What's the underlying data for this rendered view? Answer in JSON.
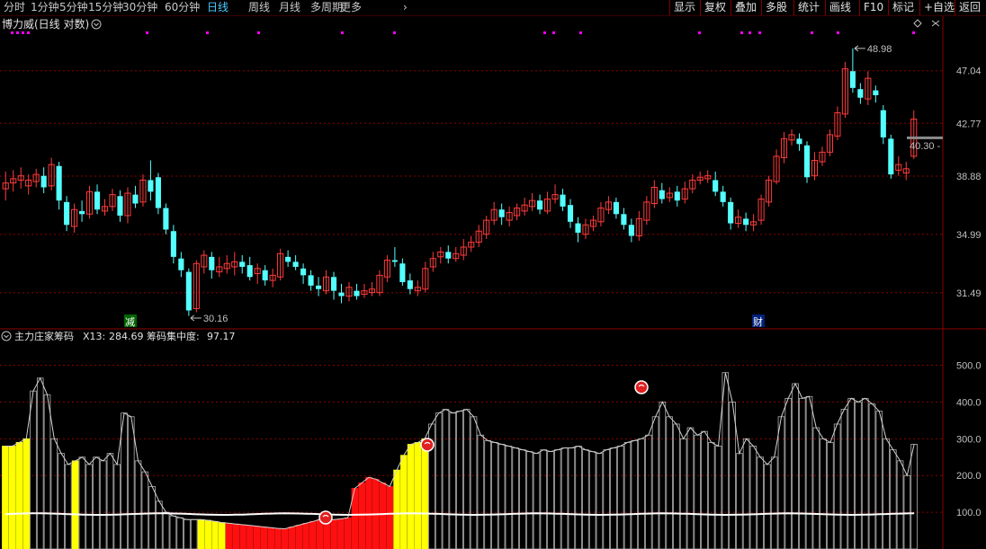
{
  "toolbar": {
    "periods": [
      "分时",
      "1分钟",
      "5分钟",
      "15分钟",
      "30分钟",
      "60分钟",
      "日线",
      "周线",
      "月线",
      "多周期",
      "更多"
    ],
    "active": "日线",
    "more_arrow": "›",
    "right": [
      "显示",
      "复权",
      "叠加",
      "多股",
      "统计",
      "画线",
      "F10",
      "标记",
      "+自选",
      "返回"
    ]
  },
  "colors": {
    "up": "#ff3b3b",
    "down": "#54ffff",
    "grid": "#8b0000",
    "axis": "#c0c0c0",
    "yellow": "#ffff00",
    "red": "#ff1010",
    "gray": "#b0b0b0",
    "line": "#ffffff",
    "accent": "#4ec8ff"
  },
  "main_panel": {
    "title": "博力威(日线 对数)",
    "max_label": "48.98",
    "min_label": "30.16",
    "current_price": "40.30",
    "marker_jian": "减",
    "marker_cai": "财",
    "y_ticks": [
      "47.04",
      "42.77",
      "38.88",
      "34.99",
      "31.49"
    ]
  },
  "indicator": {
    "name": "主力庄家筹码",
    "x13_label": "X13:",
    "x13_value": "284.69",
    "conc_label": "筹码集中度:",
    "conc_value": "97.17",
    "y_ticks": [
      "500.0",
      "400.0",
      "300.0",
      "200.0",
      "100.0"
    ]
  },
  "chart_data": [
    {
      "type": "candlestick",
      "scale": "log",
      "ylim": [
        29.5,
        50.5
      ],
      "candles": [
        {
          "o": 38.0,
          "c": 38.4,
          "h": 39.2,
          "l": 37.2
        },
        {
          "o": 38.4,
          "c": 38.7,
          "h": 39.3,
          "l": 37.8
        },
        {
          "o": 38.6,
          "c": 38.9,
          "h": 39.5,
          "l": 38.0
        },
        {
          "o": 38.2,
          "c": 38.6,
          "h": 39.0,
          "l": 37.6
        },
        {
          "o": 38.5,
          "c": 39.0,
          "h": 39.4,
          "l": 38.1
        },
        {
          "o": 38.9,
          "c": 38.1,
          "h": 39.5,
          "l": 37.7
        },
        {
          "o": 38.2,
          "c": 39.7,
          "h": 40.2,
          "l": 37.9
        },
        {
          "o": 39.6,
          "c": 37.2,
          "h": 39.9,
          "l": 36.6
        },
        {
          "o": 37.1,
          "c": 35.6,
          "h": 37.5,
          "l": 35.2
        },
        {
          "o": 35.5,
          "c": 36.6,
          "h": 37.0,
          "l": 35.1
        },
        {
          "o": 36.5,
          "c": 36.3,
          "h": 37.2,
          "l": 35.8
        },
        {
          "o": 36.3,
          "c": 37.8,
          "h": 38.2,
          "l": 36.0
        },
        {
          "o": 37.8,
          "c": 36.6,
          "h": 38.3,
          "l": 36.3
        },
        {
          "o": 36.5,
          "c": 36.8,
          "h": 37.3,
          "l": 36.2
        },
        {
          "o": 36.8,
          "c": 37.6,
          "h": 38.0,
          "l": 36.5
        },
        {
          "o": 37.5,
          "c": 36.2,
          "h": 37.9,
          "l": 35.8
        },
        {
          "o": 36.2,
          "c": 37.7,
          "h": 38.1,
          "l": 35.7
        },
        {
          "o": 37.6,
          "c": 37.0,
          "h": 38.2,
          "l": 36.7
        },
        {
          "o": 37.1,
          "c": 38.6,
          "h": 39.0,
          "l": 36.8
        },
        {
          "o": 38.6,
          "c": 37.8,
          "h": 40.0,
          "l": 37.2
        },
        {
          "o": 38.8,
          "c": 36.7,
          "h": 39.1,
          "l": 36.3
        },
        {
          "o": 36.7,
          "c": 35.3,
          "h": 37.0,
          "l": 35.0
        },
        {
          "o": 35.2,
          "c": 33.6,
          "h": 35.6,
          "l": 33.2
        },
        {
          "o": 33.5,
          "c": 32.8,
          "h": 33.9,
          "l": 32.4
        },
        {
          "o": 32.7,
          "c": 30.5,
          "h": 32.9,
          "l": 30.2
        },
        {
          "o": 30.6,
          "c": 33.2,
          "h": 33.4,
          "l": 30.4
        },
        {
          "o": 33.0,
          "c": 33.7,
          "h": 34.0,
          "l": 32.6
        },
        {
          "o": 33.6,
          "c": 32.8,
          "h": 33.9,
          "l": 32.3
        },
        {
          "o": 32.7,
          "c": 33.0,
          "h": 33.6,
          "l": 32.4
        },
        {
          "o": 32.9,
          "c": 33.2,
          "h": 33.7,
          "l": 32.6
        },
        {
          "o": 33.0,
          "c": 33.3,
          "h": 33.9,
          "l": 32.5
        },
        {
          "o": 33.3,
          "c": 33.0,
          "h": 33.7,
          "l": 32.6
        },
        {
          "o": 33.1,
          "c": 32.4,
          "h": 33.6,
          "l": 32.2
        },
        {
          "o": 32.6,
          "c": 32.9,
          "h": 33.2,
          "l": 32.0
        },
        {
          "o": 32.8,
          "c": 32.2,
          "h": 33.1,
          "l": 31.9
        },
        {
          "o": 32.2,
          "c": 32.5,
          "h": 32.9,
          "l": 31.8
        },
        {
          "o": 32.4,
          "c": 33.8,
          "h": 34.1,
          "l": 32.2
        },
        {
          "o": 33.6,
          "c": 33.3,
          "h": 34.0,
          "l": 33.0
        },
        {
          "o": 33.3,
          "c": 33.0,
          "h": 33.7,
          "l": 32.8
        },
        {
          "o": 32.9,
          "c": 32.5,
          "h": 33.2,
          "l": 32.0
        },
        {
          "o": 32.5,
          "c": 31.9,
          "h": 32.8,
          "l": 31.6
        },
        {
          "o": 31.9,
          "c": 31.7,
          "h": 32.4,
          "l": 31.3
        },
        {
          "o": 31.6,
          "c": 32.4,
          "h": 32.8,
          "l": 31.4
        },
        {
          "o": 32.4,
          "c": 31.6,
          "h": 32.7,
          "l": 31.1
        },
        {
          "o": 31.5,
          "c": 31.3,
          "h": 32.0,
          "l": 30.9
        },
        {
          "o": 31.3,
          "c": 31.8,
          "h": 32.1,
          "l": 31.0
        },
        {
          "o": 31.6,
          "c": 31.3,
          "h": 32.0,
          "l": 31.1
        },
        {
          "o": 31.4,
          "c": 31.6,
          "h": 32.0,
          "l": 31.2
        },
        {
          "o": 31.5,
          "c": 31.7,
          "h": 32.1,
          "l": 31.3
        },
        {
          "o": 31.5,
          "c": 32.5,
          "h": 32.8,
          "l": 31.3
        },
        {
          "o": 32.4,
          "c": 33.4,
          "h": 33.7,
          "l": 32.1
        },
        {
          "o": 33.4,
          "c": 33.3,
          "h": 34.2,
          "l": 33.0
        },
        {
          "o": 33.2,
          "c": 32.1,
          "h": 33.5,
          "l": 31.9
        },
        {
          "o": 32.2,
          "c": 31.7,
          "h": 32.6,
          "l": 31.4
        },
        {
          "o": 31.6,
          "c": 31.8,
          "h": 32.2,
          "l": 31.3
        },
        {
          "o": 31.7,
          "c": 32.9,
          "h": 33.3,
          "l": 31.5
        },
        {
          "o": 33.0,
          "c": 33.5,
          "h": 33.9,
          "l": 32.7
        },
        {
          "o": 33.6,
          "c": 33.9,
          "h": 34.2,
          "l": 33.2
        },
        {
          "o": 33.9,
          "c": 33.5,
          "h": 34.3,
          "l": 33.2
        },
        {
          "o": 33.5,
          "c": 33.8,
          "h": 34.2,
          "l": 33.3
        },
        {
          "o": 33.7,
          "c": 34.2,
          "h": 34.7,
          "l": 33.4
        },
        {
          "o": 34.2,
          "c": 34.5,
          "h": 34.9,
          "l": 33.9
        },
        {
          "o": 34.5,
          "c": 35.2,
          "h": 35.6,
          "l": 34.2
        },
        {
          "o": 35.0,
          "c": 35.9,
          "h": 36.2,
          "l": 34.7
        },
        {
          "o": 35.9,
          "c": 36.6,
          "h": 37.1,
          "l": 35.6
        },
        {
          "o": 36.6,
          "c": 36.1,
          "h": 37.0,
          "l": 35.6
        },
        {
          "o": 35.9,
          "c": 36.4,
          "h": 36.8,
          "l": 35.5
        },
        {
          "o": 36.2,
          "c": 36.7,
          "h": 37.0,
          "l": 35.9
        },
        {
          "o": 36.5,
          "c": 36.9,
          "h": 37.4,
          "l": 36.2
        },
        {
          "o": 36.8,
          "c": 37.2,
          "h": 37.7,
          "l": 36.5
        },
        {
          "o": 37.2,
          "c": 36.6,
          "h": 37.6,
          "l": 36.3
        },
        {
          "o": 36.5,
          "c": 37.3,
          "h": 37.8,
          "l": 36.3
        },
        {
          "o": 37.3,
          "c": 37.6,
          "h": 38.3,
          "l": 37.0
        },
        {
          "o": 37.6,
          "c": 36.8,
          "h": 38.0,
          "l": 36.5
        },
        {
          "o": 36.9,
          "c": 35.8,
          "h": 37.3,
          "l": 35.4
        },
        {
          "o": 35.7,
          "c": 35.1,
          "h": 36.1,
          "l": 34.5
        },
        {
          "o": 35.0,
          "c": 35.6,
          "h": 36.0,
          "l": 34.7
        },
        {
          "o": 35.5,
          "c": 35.9,
          "h": 36.2,
          "l": 35.2
        },
        {
          "o": 35.8,
          "c": 36.7,
          "h": 37.1,
          "l": 35.5
        },
        {
          "o": 36.6,
          "c": 37.1,
          "h": 37.5,
          "l": 36.3
        },
        {
          "o": 37.1,
          "c": 36.3,
          "h": 37.4,
          "l": 36.0
        },
        {
          "o": 36.3,
          "c": 35.6,
          "h": 36.7,
          "l": 35.3
        },
        {
          "o": 35.6,
          "c": 34.9,
          "h": 36.0,
          "l": 34.5
        },
        {
          "o": 34.9,
          "c": 36.0,
          "h": 36.5,
          "l": 34.6
        },
        {
          "o": 35.9,
          "c": 37.1,
          "h": 37.5,
          "l": 35.6
        },
        {
          "o": 37.0,
          "c": 38.1,
          "h": 38.6,
          "l": 36.7
        },
        {
          "o": 37.9,
          "c": 37.3,
          "h": 38.4,
          "l": 37.0
        },
        {
          "o": 37.4,
          "c": 37.7,
          "h": 38.1,
          "l": 37.1
        },
        {
          "o": 37.8,
          "c": 37.2,
          "h": 38.2,
          "l": 36.8
        },
        {
          "o": 37.3,
          "c": 38.0,
          "h": 38.5,
          "l": 37.0
        },
        {
          "o": 38.0,
          "c": 38.6,
          "h": 39.0,
          "l": 37.7
        },
        {
          "o": 38.6,
          "c": 38.8,
          "h": 39.2,
          "l": 38.3
        },
        {
          "o": 38.7,
          "c": 38.9,
          "h": 39.3,
          "l": 38.4
        },
        {
          "o": 38.6,
          "c": 37.8,
          "h": 39.2,
          "l": 37.5
        },
        {
          "o": 37.8,
          "c": 37.1,
          "h": 38.2,
          "l": 36.8
        },
        {
          "o": 37.1,
          "c": 35.7,
          "h": 37.4,
          "l": 35.3
        },
        {
          "o": 35.7,
          "c": 36.1,
          "h": 36.6,
          "l": 35.4
        },
        {
          "o": 36.0,
          "c": 35.6,
          "h": 36.4,
          "l": 35.2
        },
        {
          "o": 35.6,
          "c": 35.8,
          "h": 36.3,
          "l": 35.2
        },
        {
          "o": 35.9,
          "c": 37.3,
          "h": 37.6,
          "l": 35.6
        },
        {
          "o": 37.1,
          "c": 38.6,
          "h": 38.9,
          "l": 36.8
        },
        {
          "o": 38.5,
          "c": 40.3,
          "h": 40.8,
          "l": 38.3
        },
        {
          "o": 40.2,
          "c": 41.6,
          "h": 42.1,
          "l": 39.8
        },
        {
          "o": 41.5,
          "c": 41.9,
          "h": 42.3,
          "l": 41.1
        },
        {
          "o": 41.6,
          "c": 41.2,
          "h": 42.0,
          "l": 40.7
        },
        {
          "o": 41.1,
          "c": 38.8,
          "h": 41.4,
          "l": 38.4
        },
        {
          "o": 38.9,
          "c": 40.0,
          "h": 40.6,
          "l": 38.6
        },
        {
          "o": 39.9,
          "c": 40.6,
          "h": 41.0,
          "l": 39.6
        },
        {
          "o": 40.6,
          "c": 41.9,
          "h": 42.3,
          "l": 40.3
        },
        {
          "o": 41.8,
          "c": 43.6,
          "h": 44.1,
          "l": 41.5
        },
        {
          "o": 43.5,
          "c": 47.2,
          "h": 47.8,
          "l": 43.2
        },
        {
          "o": 47.0,
          "c": 45.6,
          "h": 48.98,
          "l": 45.2
        },
        {
          "o": 45.5,
          "c": 44.8,
          "h": 46.0,
          "l": 44.3
        },
        {
          "o": 44.7,
          "c": 46.4,
          "h": 47.0,
          "l": 44.2
        },
        {
          "o": 45.4,
          "c": 45.0,
          "h": 45.8,
          "l": 44.4
        },
        {
          "o": 43.8,
          "c": 41.7,
          "h": 44.2,
          "l": 41.2
        },
        {
          "o": 41.6,
          "c": 39.0,
          "h": 41.9,
          "l": 38.7
        },
        {
          "o": 39.3,
          "c": 39.7,
          "h": 40.3,
          "l": 38.9
        },
        {
          "o": 39.1,
          "c": 39.4,
          "h": 39.9,
          "l": 38.6
        },
        {
          "o": 40.3,
          "c": 43.1,
          "h": 43.8,
          "l": 40.1
        }
      ]
    },
    {
      "type": "bar",
      "ylim": [
        0,
        560
      ],
      "values": [
        280,
        280,
        290,
        300,
        430,
        465,
        420,
        300,
        260,
        230,
        240,
        250,
        230,
        250,
        240,
        260,
        230,
        370,
        360,
        240,
        210,
        170,
        130,
        100,
        90,
        85,
        80,
        80,
        80,
        78,
        75,
        72,
        70,
        68,
        66,
        64,
        62,
        60,
        58,
        56,
        55,
        60,
        65,
        70,
        75,
        80,
        78,
        80,
        82,
        85,
        165,
        180,
        195,
        190,
        180,
        170,
        215,
        255,
        285,
        290,
        300,
        340,
        370,
        380,
        370,
        375,
        380,
        360,
        310,
        295,
        290,
        285,
        280,
        275,
        270,
        265,
        260,
        270,
        265,
        270,
        275,
        275,
        280,
        270,
        265,
        260,
        270,
        275,
        280,
        290,
        295,
        300,
        310,
        360,
        400,
        360,
        340,
        300,
        330,
        310,
        320,
        290,
        280,
        480,
        400,
        260,
        300,
        280,
        250,
        230,
        250,
        360,
        410,
        450,
        410,
        415,
        330,
        300,
        290,
        340,
        380,
        410,
        400,
        410,
        395,
        375,
        300,
        270,
        240,
        200,
        285
      ],
      "colors_seq": "YYYYYYYGGGGGGGGGGYYGGGGGGGGGGGGGGGGGGGGGGGGGGGGGGYYYYYYRRRRRRRRRRRRRRRRRRRRRRRRRRRRRRRRRRRRRRRRRRRYYYYYYYYYGGGGGGGGGGGGGGGGGGGGGGGGGGGGGGGGGGGGGGGGGGGGGGGGGGGGGGGGGGGGGGGGGGGGGGGGGGGGGGGGGGGGGGGGGGGGGGGGGGGGGGGGGGGGGGGGGGGGGGGGGGGG",
      "series": [
        {
          "name": "X13",
          "values": []
        },
        {
          "name": "筹码集中度",
          "values": []
        }
      ]
    }
  ]
}
